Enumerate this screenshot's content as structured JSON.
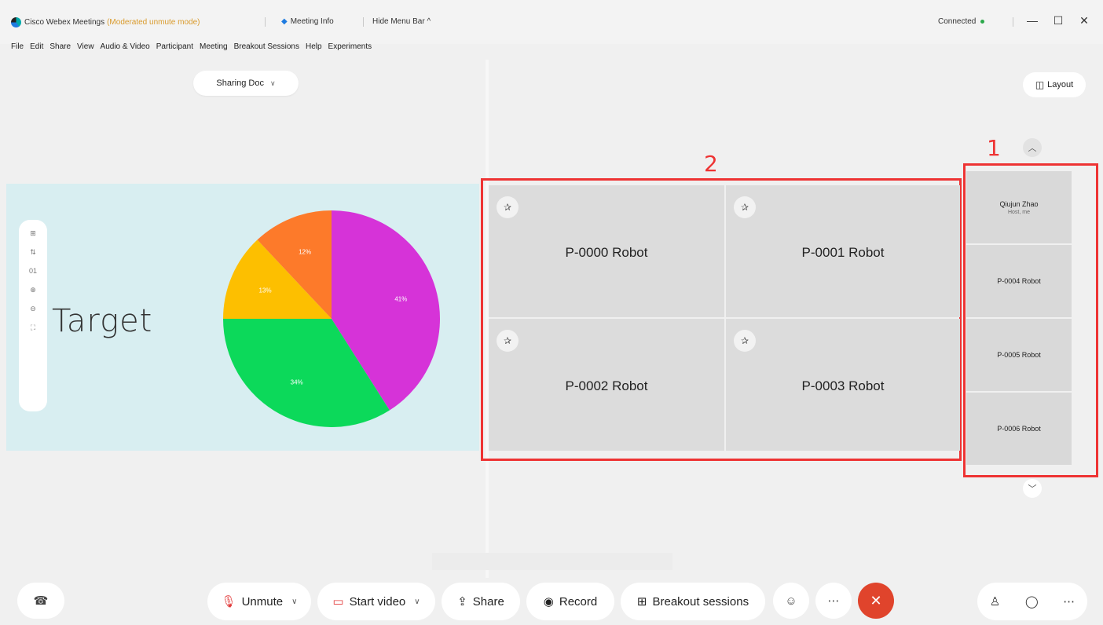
{
  "titlebar": {
    "app_title": "Cisco Webex Meetings",
    "mode": "(Moderated unmute mode)",
    "meeting_info": "Meeting Info",
    "hide_menu": "Hide Menu Bar ^",
    "status": "Connected",
    "minimize": "—",
    "maximize": "☐",
    "close": "✕"
  },
  "menu": [
    "File",
    "Edit",
    "Share",
    "View",
    "Audio & Video",
    "Participant",
    "Meeting",
    "Breakout Sessions",
    "Help",
    "Experiments"
  ],
  "sharing": {
    "dropdown_label": "Sharing Doc",
    "target_text": "Target",
    "zoom_tools": [
      "⊞",
      "⇅",
      "01",
      "⊕",
      "⊖",
      "⛶"
    ]
  },
  "chart_data": {
    "type": "pie",
    "slices": [
      {
        "label": "41%",
        "value": 41,
        "color": "#d633d8"
      },
      {
        "label": "34%",
        "value": 34,
        "color": "#0cd95a"
      },
      {
        "label": "13%",
        "value": 13,
        "color": "#fdbf00"
      },
      {
        "label": "12%",
        "value": 12,
        "color": "#fd7a2a"
      }
    ]
  },
  "grid": {
    "marker": "2",
    "tiles": [
      {
        "name": "P-0000 Robot"
      },
      {
        "name": "P-0001 Robot"
      },
      {
        "name": "P-0002 Robot"
      },
      {
        "name": "P-0003 Robot"
      }
    ]
  },
  "strip": {
    "marker": "1",
    "layout_label": "Layout",
    "host": {
      "name": "Qiujun Zhao",
      "sub": "Host, me"
    },
    "tiles": [
      "P-0004 Robot",
      "P-0005 Robot",
      "P-0006 Robot"
    ]
  },
  "toolbar": {
    "unmute": "Unmute",
    "start_video": "Start video",
    "share": "Share",
    "record": "Record",
    "breakout": "Breakout sessions"
  },
  "colors": {
    "accent_red": "#e33333",
    "end_call": "#e0442c",
    "share_bg": "#d8eef1"
  }
}
